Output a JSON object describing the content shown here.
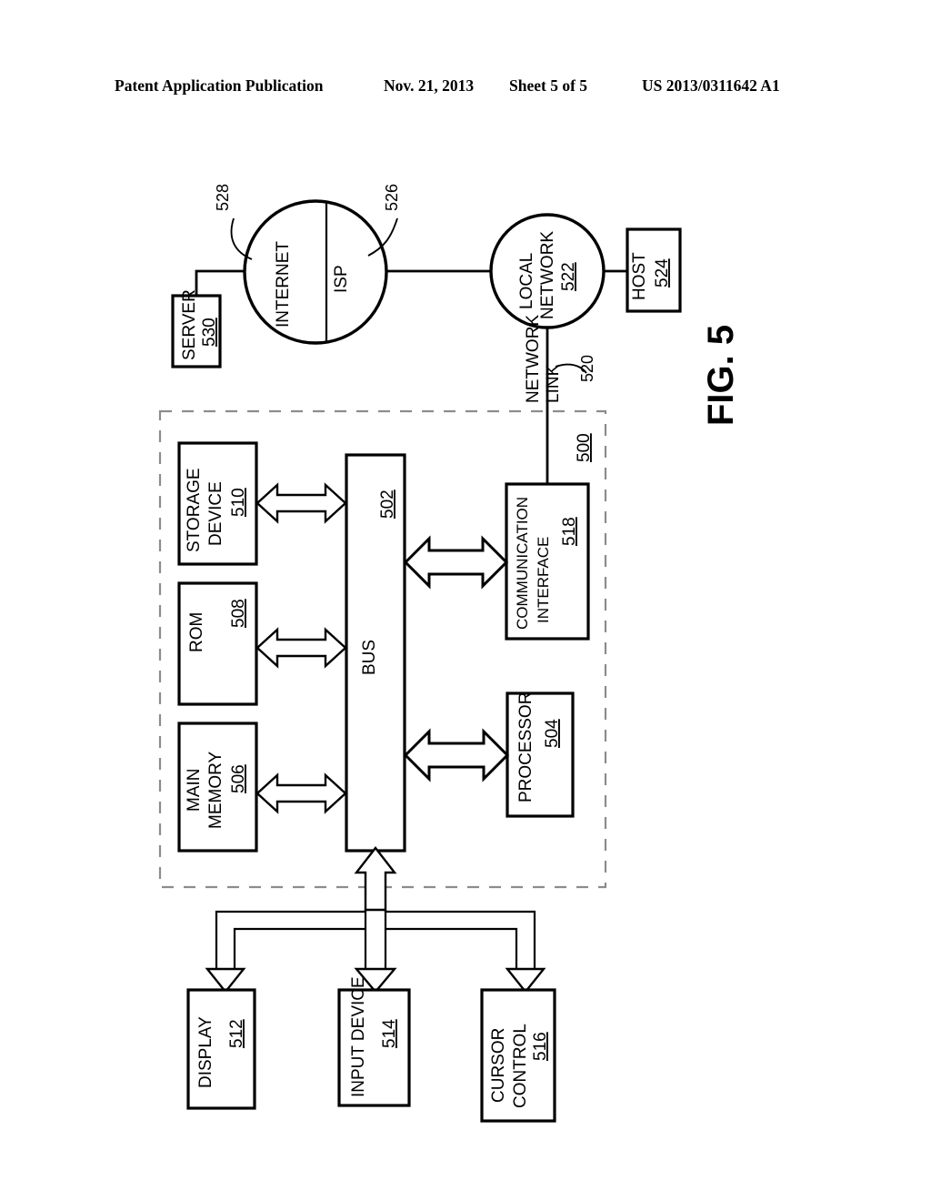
{
  "header": {
    "publication": "Patent Application Publication",
    "date": "Nov. 21, 2013",
    "sheet": "Sheet 5 of 5",
    "patent_number": "US 2013/0311642 A1"
  },
  "figure": {
    "label": "FIG. 5",
    "system_ref": "500"
  },
  "nodes": {
    "server": {
      "label": "SERVER",
      "ref": "530"
    },
    "internet": {
      "label": "INTERNET",
      "ref": "528"
    },
    "isp": {
      "label": "ISP",
      "ref": "526"
    },
    "local_network": {
      "label_line1": "LOCAL",
      "label_line2": "NETWORK",
      "ref": "522"
    },
    "host": {
      "label": "HOST",
      "ref": "524"
    },
    "network_link": {
      "label_line1": "NETWORK",
      "label_line2": "LINK",
      "ref": "520"
    },
    "storage_device": {
      "label_line1": "STORAGE",
      "label_line2": "DEVICE",
      "ref": "510"
    },
    "rom": {
      "label": "ROM",
      "ref": "508"
    },
    "main_memory": {
      "label_line1": "MAIN",
      "label_line2": "MEMORY",
      "ref": "506"
    },
    "bus": {
      "label": "BUS",
      "ref": "502"
    },
    "communication_interface": {
      "label_line1": "COMMUNICATION",
      "label_line2": "INTERFACE",
      "ref": "518"
    },
    "processor": {
      "label": "PROCESSOR",
      "ref": "504"
    },
    "display": {
      "label": "DISPLAY",
      "ref": "512"
    },
    "input_device": {
      "label": "INPUT DEVICE",
      "ref": "514"
    },
    "cursor_control": {
      "label_line1": "CURSOR",
      "label_line2": "CONTROL",
      "ref": "516"
    }
  },
  "colors": {
    "ink": "#000000",
    "paper": "#ffffff",
    "dashed_boundary": "#8c8c8c"
  }
}
